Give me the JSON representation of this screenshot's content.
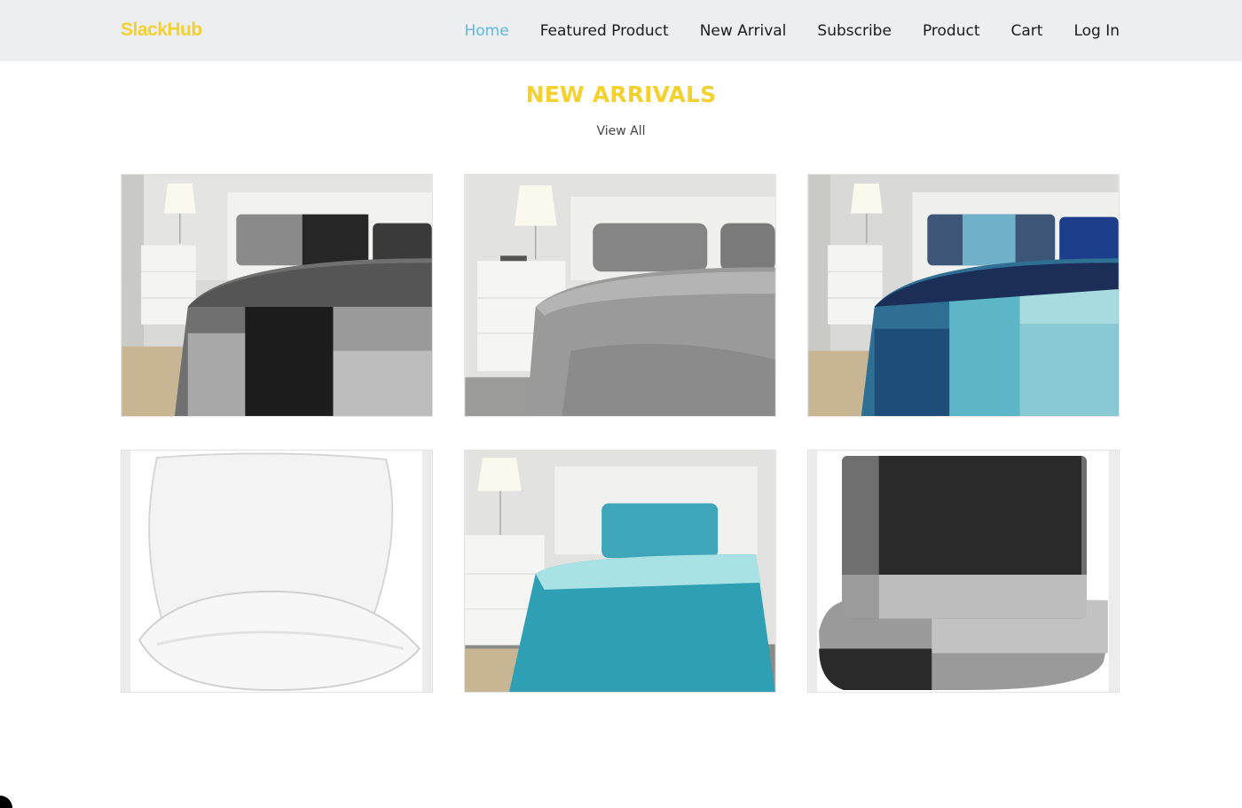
{
  "brand": {
    "name": "SlackHub"
  },
  "nav": {
    "items": [
      {
        "label": "Home",
        "active": true
      },
      {
        "label": "Featured Product",
        "active": false
      },
      {
        "label": "New Arrival",
        "active": false
      },
      {
        "label": "Subscribe",
        "active": false
      },
      {
        "label": "Product",
        "active": false
      },
      {
        "label": "Cart",
        "active": false
      },
      {
        "label": "Log In",
        "active": false
      }
    ]
  },
  "section": {
    "title": "NEW ARRIVALS",
    "view_all": "View All"
  },
  "products": [
    {
      "icon": "bedding-image"
    },
    {
      "icon": "bedding-image"
    },
    {
      "icon": "bedding-image"
    },
    {
      "icon": "pillow-image"
    },
    {
      "icon": "bedding-image"
    },
    {
      "icon": "bedding-image"
    }
  ],
  "colors": {
    "accent": "#f5d130",
    "active_link": "#5fb8e0",
    "navbar_bg": "#eceef0"
  }
}
